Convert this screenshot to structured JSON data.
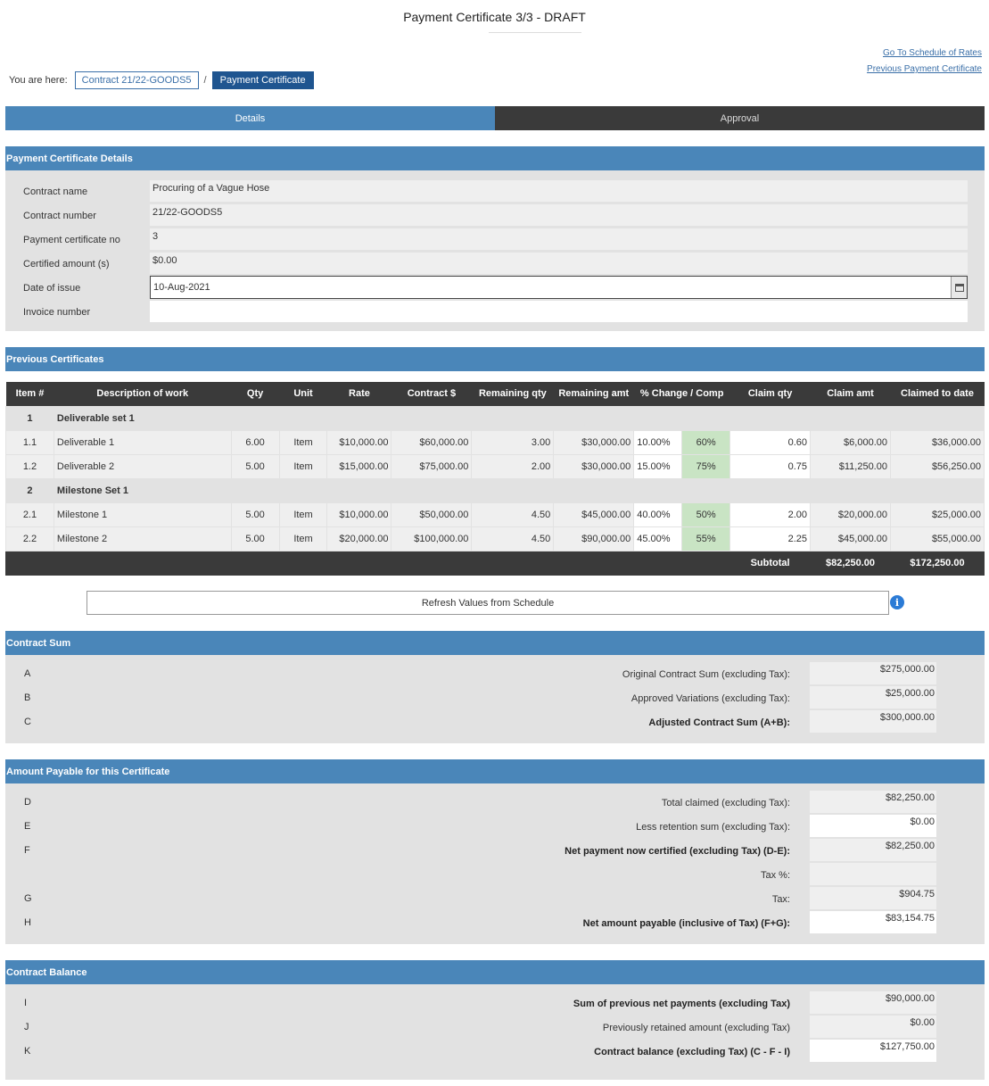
{
  "page": {
    "title": "Payment Certificate 3/3 - DRAFT"
  },
  "links": {
    "schedule": "Go To Schedule of Rates",
    "previous": "Previous Payment Certificate"
  },
  "breadcrumb": {
    "label": "You are here:",
    "contract": "Contract 21/22-GOODS5",
    "separator": "/",
    "current": "Payment Certificate"
  },
  "tabs": {
    "details": "Details",
    "approval": "Approval"
  },
  "details": {
    "header": "Payment Certificate Details",
    "rows": [
      {
        "label": "Contract name",
        "value": "Procuring of a Vague Hose"
      },
      {
        "label": "Contract number",
        "value": "21/22-GOODS5"
      },
      {
        "label": "Payment certificate no",
        "value": "3"
      },
      {
        "label": "Certified amount (s)",
        "value": "$0.00"
      },
      {
        "label": "Date of issue",
        "value": "10-Aug-2021"
      },
      {
        "label": "Invoice number",
        "value": ""
      }
    ]
  },
  "previous": {
    "header": "Previous Certificates",
    "columns": [
      "Item #",
      "Description of work",
      "Qty",
      "Unit",
      "Rate",
      "Contract $",
      "Remaining qty",
      "Remaining amt",
      "% Change / Comp",
      "Claim qty",
      "Claim amt",
      "Claimed to date"
    ],
    "groups": [
      {
        "num": "1",
        "name": "Deliverable set 1",
        "items": [
          {
            "num": "1.1",
            "desc": "Deliverable 1",
            "qty": "6.00",
            "unit": "Item",
            "rate": "$10,000.00",
            "contract": "$60,000.00",
            "rem_qty": "3.00",
            "rem_amt": "$30,000.00",
            "change": "10.00%",
            "comp": "60%",
            "claim_qty": "0.60",
            "claim_amt": "$6,000.00",
            "to_date": "$36,000.00"
          },
          {
            "num": "1.2",
            "desc": "Deliverable 2",
            "qty": "5.00",
            "unit": "Item",
            "rate": "$15,000.00",
            "contract": "$75,000.00",
            "rem_qty": "2.00",
            "rem_amt": "$30,000.00",
            "change": "15.00%",
            "comp": "75%",
            "claim_qty": "0.75",
            "claim_amt": "$11,250.00",
            "to_date": "$56,250.00"
          }
        ]
      },
      {
        "num": "2",
        "name": "Milestone Set 1",
        "items": [
          {
            "num": "2.1",
            "desc": "Milestone 1",
            "qty": "5.00",
            "unit": "Item",
            "rate": "$10,000.00",
            "contract": "$50,000.00",
            "rem_qty": "4.50",
            "rem_amt": "$45,000.00",
            "change": "40.00%",
            "comp": "50%",
            "claim_qty": "2.00",
            "claim_amt": "$20,000.00",
            "to_date": "$25,000.00"
          },
          {
            "num": "2.2",
            "desc": "Milestone 2",
            "qty": "5.00",
            "unit": "Item",
            "rate": "$20,000.00",
            "contract": "$100,000.00",
            "rem_qty": "4.50",
            "rem_amt": "$90,000.00",
            "change": "45.00%",
            "comp": "55%",
            "claim_qty": "2.25",
            "claim_amt": "$45,000.00",
            "to_date": "$55,000.00"
          }
        ]
      }
    ],
    "subtotal_label": "Subtotal",
    "subtotal_claim": "$82,250.00",
    "subtotal_to_date": "$172,250.00"
  },
  "refresh_label": "Refresh Values from Schedule",
  "contract_sum": {
    "header": "Contract Sum",
    "rows": [
      {
        "letter": "A",
        "label": "Original Contract Sum (excluding Tax):",
        "value": "$275,000.00"
      },
      {
        "letter": "B",
        "label": "Approved Variations (excluding Tax):",
        "value": "$25,000.00"
      },
      {
        "letter": "C",
        "label": "Adjusted Contract Sum (A+B):",
        "value": "$300,000.00"
      }
    ]
  },
  "payable": {
    "header": "Amount Payable for this Certificate",
    "rows": [
      {
        "letter": "D",
        "label": "Total claimed (excluding Tax):",
        "value": "$82,250.00"
      },
      {
        "letter": "E",
        "label": "Less retention sum (excluding Tax):",
        "value": "$0.00"
      },
      {
        "letter": "F",
        "label": "Net payment now certified (excluding Tax) (D-E):",
        "value": "$82,250.00"
      },
      {
        "letter": "",
        "label": "Tax %:",
        "value": ""
      },
      {
        "letter": "G",
        "label": "Tax:",
        "value": "$904.75"
      },
      {
        "letter": "H",
        "label": "Net amount payable (inclusive of Tax) (F+G):",
        "value": "$83,154.75"
      }
    ]
  },
  "balance": {
    "header": "Contract Balance",
    "rows": [
      {
        "letter": "I",
        "label": "Sum of previous net payments (excluding Tax)",
        "value": "$90,000.00"
      },
      {
        "letter": "J",
        "label": "Previously retained amount (excluding Tax)",
        "value": "$0.00"
      },
      {
        "letter": "K",
        "label": "Contract balance (excluding Tax) (C - F - I)",
        "value": "$127,750.00"
      }
    ]
  }
}
